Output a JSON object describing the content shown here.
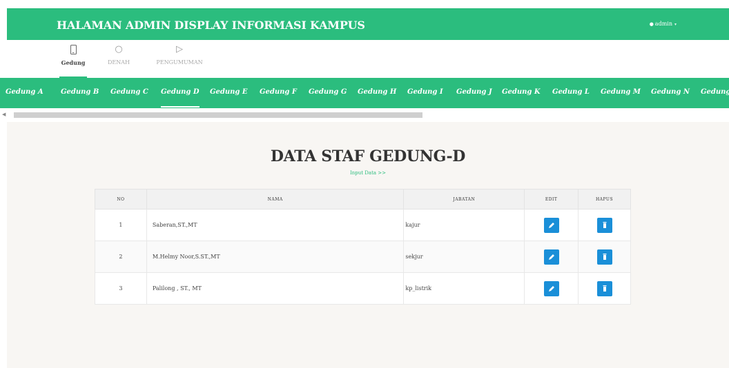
{
  "header": {
    "title": "HALAMAN ADMIN DISPLAY INFORMASI KAMPUS",
    "user": "admin"
  },
  "icon_tabs": [
    {
      "label": "Gedung",
      "icon": "tablet-icon",
      "active": true
    },
    {
      "label": "DENAH",
      "icon": "globe-icon",
      "active": false
    },
    {
      "label": "PENGUMUMAN",
      "icon": "megaphone-icon",
      "active": false
    }
  ],
  "gedung_tabs": [
    "Gedung A",
    "Gedung B",
    "Gedung C",
    "Gedung D",
    "Gedung E",
    "Gedung F",
    "Gedung G",
    "Gedung H",
    "Gedung I",
    "Gedung J",
    "Gedung K",
    "Gedung L",
    "Gedung M",
    "Gedung N",
    "Gedung"
  ],
  "main": {
    "title": "DATA STAF GEDUNG-D",
    "input_link": "Input Data >>"
  },
  "table": {
    "columns": [
      "NO",
      "NAMA",
      "JABATAN",
      "EDIT",
      "HAPUS"
    ],
    "rows": [
      {
        "no": "1",
        "nama": "Saberan,ST.,MT",
        "jabatan": "kajur"
      },
      {
        "no": "2",
        "nama": "M.Helmy Noor,S.ST.,MT",
        "jabatan": "sekjur"
      },
      {
        "no": "3",
        "nama": "Palilong , ST., MT",
        "jabatan": "kp_listrik"
      }
    ]
  },
  "colors": {
    "accent": "#2bbd7e",
    "button": "#1a8fd8",
    "content_bg": "#f8f6f3"
  }
}
